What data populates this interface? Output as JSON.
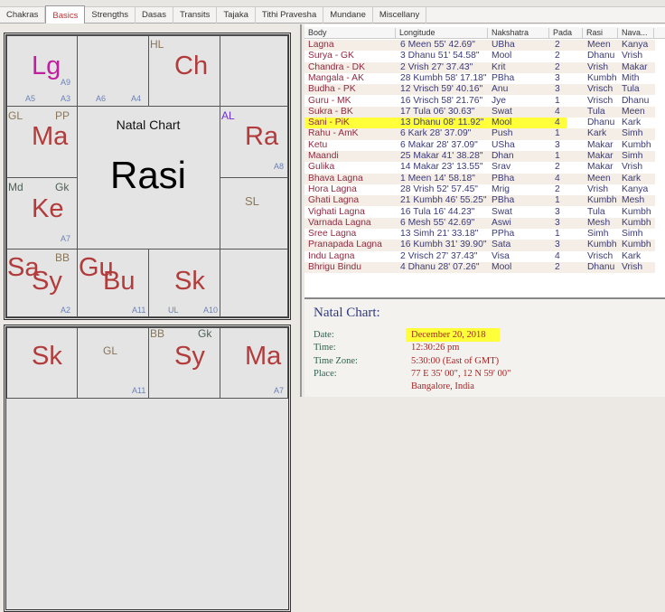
{
  "tabs": [
    "Chakras",
    "Basics",
    "Strengths",
    "Dasas",
    "Transits",
    "Tajaka",
    "Tithi Pravesha",
    "Mundane",
    "Miscellany"
  ],
  "active_tab": "Basics",
  "rasi_chart": {
    "title": "Natal Chart",
    "name": "Rasi",
    "labels": {
      "Lg": "Lg",
      "A9": "A9",
      "A5": "A5",
      "A3": "A3",
      "A6": "A6",
      "A4": "A4",
      "HL": "HL",
      "Ch": "Ch",
      "GL": "GL",
      "PP": "PP",
      "Ma": "Ma",
      "AL": "AL",
      "Ra": "Ra",
      "A8": "A8",
      "SL": "SL",
      "Md": "Md",
      "Gk": "Gk",
      "Ke": "Ke",
      "A7": "A7",
      "BB": "BB",
      "Sa": "Sa",
      "Sy": "Sy",
      "Gu": "Gu",
      "Bu": "Bu",
      "Sk": "Sk",
      "A2": "A2",
      "A11": "A11",
      "UL": "UL",
      "A10": "A10"
    }
  },
  "second_chart": {
    "labels": {
      "Sk": "Sk",
      "GL": "GL",
      "BB": "BB",
      "Gk": "Gk",
      "Sy": "Sy",
      "Ma": "Ma",
      "A11": "A11",
      "A7": "A7"
    }
  },
  "table": {
    "columns": [
      "Body",
      "Longitude",
      "Nakshatra",
      "Pada",
      "Rasi",
      "Nava..."
    ],
    "highlighted_row": "Sani - PiK",
    "rows": [
      [
        "Lagna",
        "6 Meen 55' 42.69\"",
        "UBha",
        "2",
        "Meen",
        "Kanya"
      ],
      [
        "Surya - GK",
        "3 Dhanu 51' 54.58\"",
        "Mool",
        "2",
        "Dhanu",
        "Vrish"
      ],
      [
        "Chandra - DK",
        "2 Vrish 27' 37.43\"",
        "Krit",
        "2",
        "Vrish",
        "Makar"
      ],
      [
        "Mangala - AK",
        "28 Kumbh 58' 17.18\"",
        "PBha",
        "3",
        "Kumbh",
        "Mith"
      ],
      [
        "Budha - PK",
        "12 Vrisch 59' 40.16\"",
        "Anu",
        "3",
        "Vrisch",
        "Tula"
      ],
      [
        "Guru - MK",
        "16 Vrisch 58' 21.76\"",
        "Jye",
        "1",
        "Vrisch",
        "Dhanu"
      ],
      [
        "Sukra - BK",
        "17 Tula 06' 30.63\"",
        "Swat",
        "4",
        "Tula",
        "Meen"
      ],
      [
        "Sani - PiK",
        "13 Dhanu 08' 11.92\"",
        "Mool",
        "4",
        "Dhanu",
        "Kark"
      ],
      [
        "Rahu - AmK",
        "6 Kark 28' 37.09\"",
        "Push",
        "1",
        "Kark",
        "Simh"
      ],
      [
        "Ketu",
        "6 Makar 28' 37.09\"",
        "USha",
        "3",
        "Makar",
        "Kumbh"
      ],
      [
        "Maandi",
        "25 Makar 41' 38.28\"",
        "Dhan",
        "1",
        "Makar",
        "Simh"
      ],
      [
        "Gulika",
        "14 Makar 23' 13.55\"",
        "Srav",
        "2",
        "Makar",
        "Vrish"
      ],
      [
        "Bhava Lagna",
        "1 Meen 14' 58.18\"",
        "PBha",
        "4",
        "Meen",
        "Kark"
      ],
      [
        "Hora Lagna",
        "28 Vrish 52' 57.45\"",
        "Mrig",
        "2",
        "Vrish",
        "Kanya"
      ],
      [
        "Ghati Lagna",
        "21 Kumbh 46' 55.25\"",
        "PBha",
        "1",
        "Kumbh",
        "Mesh"
      ],
      [
        "Vighati Lagna",
        "16 Tula 16' 44.23\"",
        "Swat",
        "3",
        "Tula",
        "Kumbh"
      ],
      [
        "Varnada Lagna",
        "6 Mesh 55' 42.69\"",
        "Aswi",
        "3",
        "Mesh",
        "Kumbh"
      ],
      [
        "Sree Lagna",
        "13 Simh 21' 33.18\"",
        "PPha",
        "1",
        "Simh",
        "Simh"
      ],
      [
        "Pranapada Lagna",
        "16 Kumbh 31' 39.90\"",
        "Sata",
        "3",
        "Kumbh",
        "Kumbh"
      ],
      [
        "Indu Lagna",
        "2 Vrisch 27' 37.43\"",
        "Visa",
        "4",
        "Vrisch",
        "Kark"
      ],
      [
        "Bhrigu Bindu",
        "4 Dhanu 28' 07.26\"",
        "Mool",
        "2",
        "Dhanu",
        "Vrish"
      ]
    ]
  },
  "details": {
    "heading": "Natal Chart:",
    "date_label": "Date:",
    "date": "December 20, 2018",
    "time_label": "Time:",
    "time": "12:30:26 pm",
    "tz_label": "Time Zone:",
    "tz": "5:30:00 (East of GMT)",
    "place_label": "Place:",
    "coords": "77 E 35' 00\", 12 N 59' 00\"",
    "place": "Bangalore, India"
  },
  "colors": {
    "planet": "#b23b3b",
    "lagna": "#c21fa0",
    "arudha": "#6b82b5",
    "highlight": "#ffff3a",
    "value": "#a52525"
  }
}
